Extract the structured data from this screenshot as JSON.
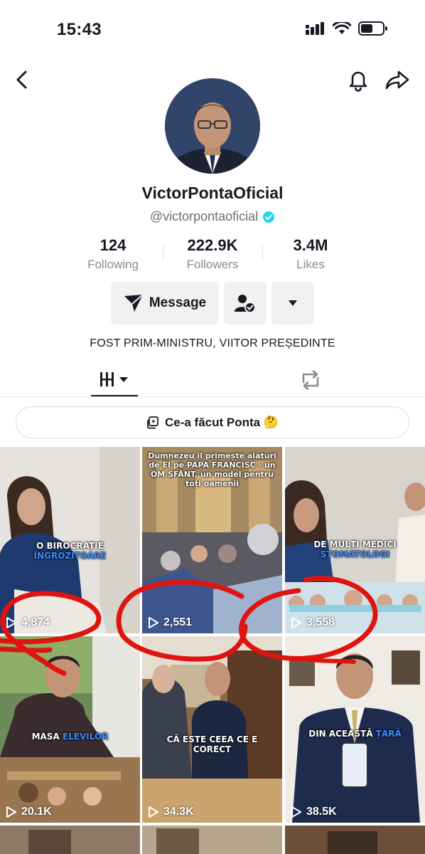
{
  "status_bar": {
    "time": "15:43"
  },
  "nav": {
    "back_icon": "chevron-left-icon",
    "bell_icon": "bell-icon",
    "share_icon": "share-arrow-icon"
  },
  "profile": {
    "display_name": "VictorPontaOficial",
    "handle": "@victorpontaoficial",
    "verified": true,
    "verified_color": "#20d5ec",
    "bio": "FOST PRIM-MINISTRU, VIITOR PREȘEDINTE"
  },
  "stats": {
    "following": {
      "value": "124",
      "label": "Following"
    },
    "followers": {
      "value": "222.9K",
      "label": "Followers"
    },
    "likes": {
      "value": "3.4M",
      "label": "Likes"
    }
  },
  "actions": {
    "message_label": "Message",
    "follow_icon": "user-check-icon",
    "more_icon": "caret-down-icon"
  },
  "tabs": [
    {
      "name": "videos",
      "icon": "grid-bars-icon",
      "active": true
    },
    {
      "name": "reposts",
      "icon": "repost-icon",
      "active": false
    }
  ],
  "playlist": {
    "label": "Ce-a făcut Ponta 🤔"
  },
  "videos": [
    {
      "views": "4,874",
      "caption_main": "O BIROCRAȚIE",
      "caption_highlight": "ÎNGROZITOARE"
    },
    {
      "views": "2,551",
      "caption_top": "Dumnezeu îl primește alături de El pe PAPA FRANCISC - un OM SFÂNT, un model pentru toți oamenii"
    },
    {
      "views": "3,558",
      "caption_main": "DE MULȚI MEDICI",
      "caption_highlight": "STOMATOLOGI"
    },
    {
      "views": "20.1K",
      "caption_main": "MASA",
      "caption_highlight": "ELEVILOR"
    },
    {
      "views": "34.3K",
      "caption_main": "CĂ ESTE CEEA CE E CORECT"
    },
    {
      "views": "38.5K",
      "caption_main": "DIN ACEASTĂ",
      "caption_highlight": "ȚARĂ"
    }
  ],
  "colors": {
    "accent_highlight": "#3a8dff",
    "annotation_red": "#e0140e"
  }
}
